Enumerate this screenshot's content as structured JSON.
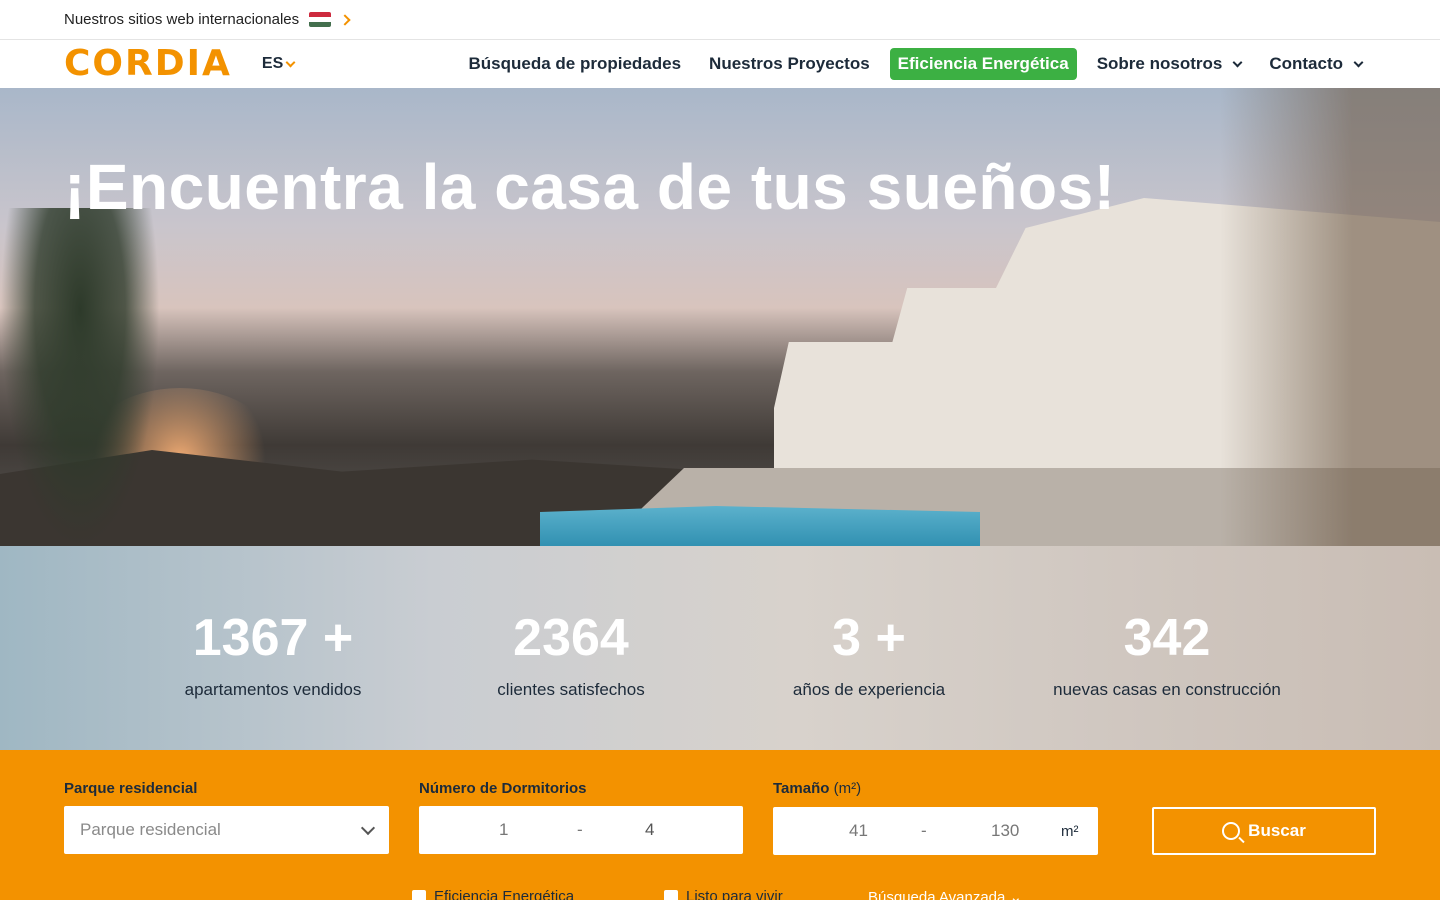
{
  "topbar": {
    "international_label": "Nuestros sitios web internacionales",
    "flag_icon": "hungary-flag-icon",
    "flag_colors": [
      "#cd2a3e",
      "#ffffff",
      "#436f4d"
    ]
  },
  "nav": {
    "logo": "CORDIA",
    "lang": "ES",
    "items": [
      {
        "label": "Búsqueda de propiedades"
      },
      {
        "label": "Nuestros Proyectos"
      },
      {
        "label": "Eficiencia Energética"
      },
      {
        "label": "Sobre nosotros"
      },
      {
        "label": "Contacto"
      }
    ],
    "accent": "#f39200",
    "highlight": "#3cb043"
  },
  "hero": {
    "title": "¡Encuentra la casa de tus sueños!"
  },
  "stats": [
    {
      "value": "1367 +",
      "label": "apartamentos vendidos"
    },
    {
      "value": "2364",
      "label": "clientes satisfechos"
    },
    {
      "value": "3 +",
      "label": "años de experiencia"
    },
    {
      "value": "342",
      "label": "nuevas casas en construcción"
    }
  ],
  "search": {
    "park_label": "Parque residencial",
    "park_placeholder": "Parque residencial",
    "bedrooms_label": "Número de Dormitorios",
    "bedrooms_min": "1",
    "bedrooms_max": "4",
    "size_label": "Tamaño",
    "size_unit_label": "(m²)",
    "size_min": "41",
    "size_max": "130",
    "size_unit": "m²",
    "dash": "-",
    "search_button": "Buscar",
    "check_energy": "Eficiencia Energética",
    "check_ready": "Listo para vivir",
    "advanced": "Búsqueda Avanzada ⌄"
  }
}
